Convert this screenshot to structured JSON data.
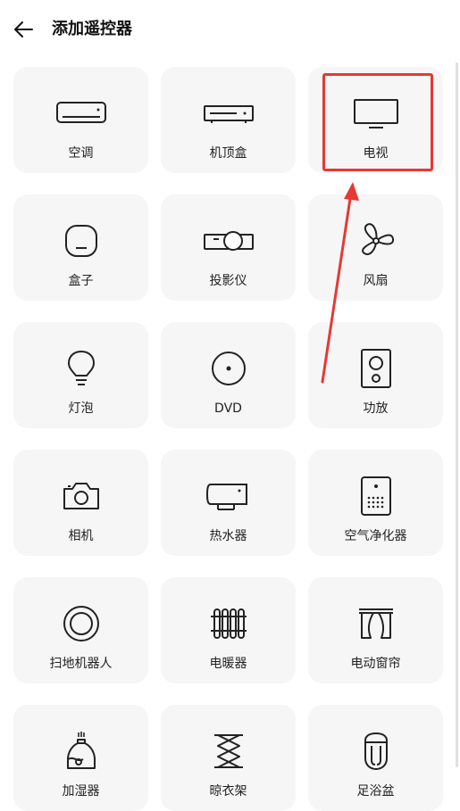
{
  "header": {
    "title": "添加遥控器",
    "back_icon": "back-arrow-icon"
  },
  "devices": [
    {
      "label": "空调",
      "icon": "air-conditioner-icon"
    },
    {
      "label": "机顶盒",
      "icon": "set-top-box-icon"
    },
    {
      "label": "电视",
      "icon": "tv-icon"
    },
    {
      "label": "盒子",
      "icon": "box-icon"
    },
    {
      "label": "投影仪",
      "icon": "projector-icon"
    },
    {
      "label": "风扇",
      "icon": "fan-icon"
    },
    {
      "label": "灯泡",
      "icon": "bulb-icon"
    },
    {
      "label": "DVD",
      "icon": "dvd-icon"
    },
    {
      "label": "功放",
      "icon": "amplifier-icon"
    },
    {
      "label": "相机",
      "icon": "camera-icon"
    },
    {
      "label": "热水器",
      "icon": "water-heater-icon"
    },
    {
      "label": "空气净化器",
      "icon": "air-purifier-icon"
    },
    {
      "label": "扫地机器人",
      "icon": "robot-vacuum-icon"
    },
    {
      "label": "电暖器",
      "icon": "heater-icon"
    },
    {
      "label": "电动窗帘",
      "icon": "curtain-icon"
    },
    {
      "label": "加湿器",
      "icon": "humidifier-icon"
    },
    {
      "label": "晾衣架",
      "icon": "clothes-rack-icon"
    },
    {
      "label": "足浴盆",
      "icon": "foot-bath-icon"
    }
  ],
  "annotation": {
    "highlight_color": "#e53935"
  }
}
